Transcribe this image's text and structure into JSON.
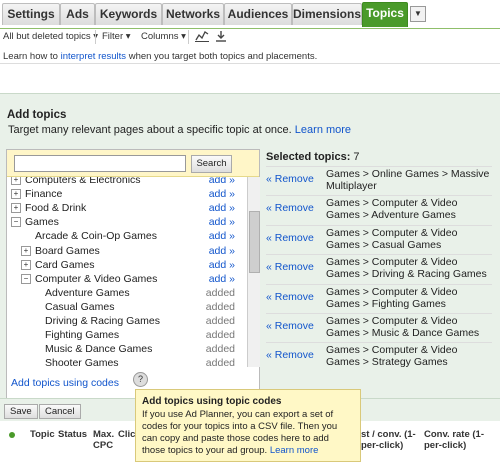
{
  "tabs": [
    "Settings",
    "Ads",
    "Keywords",
    "Networks",
    "Audiences",
    "Dimensions",
    "Topics"
  ],
  "active_tab": "Topics",
  "tab_more_icon": "dropdown-arrow-icon",
  "toolbar": {
    "filter_scope": "All but deleted topics ▾",
    "filter": "Filter ▾",
    "columns": "Columns ▾",
    "chart_icon": "chart-icon",
    "download_icon": "download-icon"
  },
  "learn": {
    "prefix": "Learn how to ",
    "link": "interpret results",
    "suffix": " when you target both topics and placements."
  },
  "add_topics": {
    "title": "Add topics",
    "subtitle": "Target many relevant pages about a specific topic at once.",
    "learn_more": "Learn more",
    "search_value": "",
    "search_button": "Search",
    "tree": [
      {
        "label": "Computers & Electronics",
        "expander": "+",
        "indent": 0,
        "action": "add »"
      },
      {
        "label": "Finance",
        "expander": "+",
        "indent": 0,
        "action": "add »"
      },
      {
        "label": "Food & Drink",
        "expander": "+",
        "indent": 0,
        "action": "add »"
      },
      {
        "label": "Games",
        "expander": "−",
        "indent": 0,
        "action": "add »"
      },
      {
        "label": "Arcade & Coin-Op Games",
        "expander": "",
        "indent": 1,
        "action": "add »"
      },
      {
        "label": "Board Games",
        "expander": "+",
        "indent": 1,
        "action": "add »"
      },
      {
        "label": "Card Games",
        "expander": "+",
        "indent": 1,
        "action": "add »"
      },
      {
        "label": "Computer & Video Games",
        "expander": "−",
        "indent": 1,
        "action": "add »"
      },
      {
        "label": "Adventure Games",
        "expander": "",
        "indent": 2,
        "action": "added"
      },
      {
        "label": "Casual Games",
        "expander": "",
        "indent": 2,
        "action": "added"
      },
      {
        "label": "Driving & Racing Games",
        "expander": "",
        "indent": 2,
        "action": "added"
      },
      {
        "label": "Fighting Games",
        "expander": "",
        "indent": 2,
        "action": "added"
      },
      {
        "label": "Music & Dance Games",
        "expander": "",
        "indent": 2,
        "action": "added"
      },
      {
        "label": "Shooter Games",
        "expander": "",
        "indent": 2,
        "action": "added"
      }
    ],
    "add_codes": "Add topics using codes",
    "help_icon": "help-icon"
  },
  "selected": {
    "label": "Selected topics:",
    "count": "7",
    "remove_label": "« Remove",
    "items": [
      "Games > Online Games > Massive Multiplayer",
      "Games > Computer & Video Games > Adventure Games",
      "Games > Computer & Video Games > Casual Games",
      "Games > Computer & Video Games > Driving & Racing Games",
      "Games > Computer & Video Games > Fighting Games",
      "Games > Computer & Video Games > Music & Dance Games",
      "Games > Computer & Video Games > Strategy Games"
    ]
  },
  "buttons": {
    "save": "Save",
    "cancel": "Cancel"
  },
  "columns": {
    "topic": "Topic",
    "status": "Status",
    "max_cpc_1": "Max.",
    "max_cpc_2": "CPC",
    "clicks": "Click",
    "cost_conv_1": "st / conv. (1-",
    "cost_conv_2": "per-click)",
    "conv_rate_1": "Conv. rate (1-",
    "conv_rate_2": "per-click)"
  },
  "tooltip": {
    "title": "Add topics using topic codes",
    "body": "If you use Ad Planner, you can export a set of codes for your topics into a CSV file. Then you can copy and paste those codes here to add those topics to your ad group.",
    "learn_more": "Learn more"
  }
}
